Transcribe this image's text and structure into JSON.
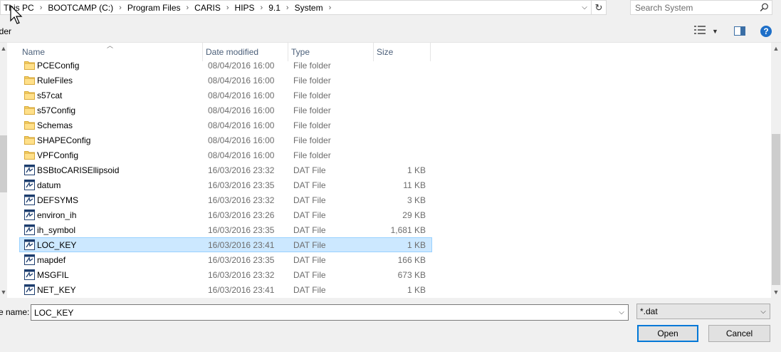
{
  "address": {
    "crumbs": [
      "This PC",
      "BOOTCAMP (C:)",
      "Program Files",
      "CARIS",
      "HIPS",
      "9.1",
      "System"
    ],
    "separator": "›"
  },
  "search": {
    "placeholder": "Search System"
  },
  "toolbar": {
    "left_label": "lder"
  },
  "columns": {
    "name": "Name",
    "date": "Date modified",
    "type": "Type",
    "size": "Size"
  },
  "files": [
    {
      "name": "PCEConfig",
      "date": "08/04/2016 16:00",
      "type": "File folder",
      "size": "",
      "kind": "folder"
    },
    {
      "name": "RuleFiles",
      "date": "08/04/2016 16:00",
      "type": "File folder",
      "size": "",
      "kind": "folder"
    },
    {
      "name": "s57cat",
      "date": "08/04/2016 16:00",
      "type": "File folder",
      "size": "",
      "kind": "folder"
    },
    {
      "name": "s57Config",
      "date": "08/04/2016 16:00",
      "type": "File folder",
      "size": "",
      "kind": "folder"
    },
    {
      "name": "Schemas",
      "date": "08/04/2016 16:00",
      "type": "File folder",
      "size": "",
      "kind": "folder"
    },
    {
      "name": "SHAPEConfig",
      "date": "08/04/2016 16:00",
      "type": "File folder",
      "size": "",
      "kind": "folder"
    },
    {
      "name": "VPFConfig",
      "date": "08/04/2016 16:00",
      "type": "File folder",
      "size": "",
      "kind": "folder"
    },
    {
      "name": "BSBtoCARISEllipsoid",
      "date": "16/03/2016 23:32",
      "type": "DAT File",
      "size": "1 KB",
      "kind": "file"
    },
    {
      "name": "datum",
      "date": "16/03/2016 23:35",
      "type": "DAT File",
      "size": "11 KB",
      "kind": "file"
    },
    {
      "name": "DEFSYMS",
      "date": "16/03/2016 23:32",
      "type": "DAT File",
      "size": "3 KB",
      "kind": "file"
    },
    {
      "name": "environ_ih",
      "date": "16/03/2016 23:26",
      "type": "DAT File",
      "size": "29 KB",
      "kind": "file"
    },
    {
      "name": "ih_symbol",
      "date": "16/03/2016 23:35",
      "type": "DAT File",
      "size": "1,681 KB",
      "kind": "file"
    },
    {
      "name": "LOC_KEY",
      "date": "16/03/2016 23:41",
      "type": "DAT File",
      "size": "1 KB",
      "kind": "file",
      "selected": true
    },
    {
      "name": "mapdef",
      "date": "16/03/2016 23:35",
      "type": "DAT File",
      "size": "166 KB",
      "kind": "file"
    },
    {
      "name": "MSGFIL",
      "date": "16/03/2016 23:32",
      "type": "DAT File",
      "size": "673 KB",
      "kind": "file"
    },
    {
      "name": "NET_KEY",
      "date": "16/03/2016 23:41",
      "type": "DAT File",
      "size": "1 KB",
      "kind": "file"
    }
  ],
  "bottom": {
    "filename_label": "e name:",
    "filename_value": "LOC_KEY",
    "filetype_value": "*.dat",
    "open_label": "Open",
    "cancel_label": "Cancel"
  },
  "colors": {
    "selection": "#cce8ff",
    "selection_border": "#99d1ff",
    "folder": "#f6d365",
    "accent": "#0078d7"
  },
  "icons": [
    "folder-icon",
    "dat-file-icon",
    "search-icon",
    "refresh-icon",
    "chevron-down-icon",
    "help-icon",
    "view-options-icon",
    "preview-pane-icon"
  ]
}
